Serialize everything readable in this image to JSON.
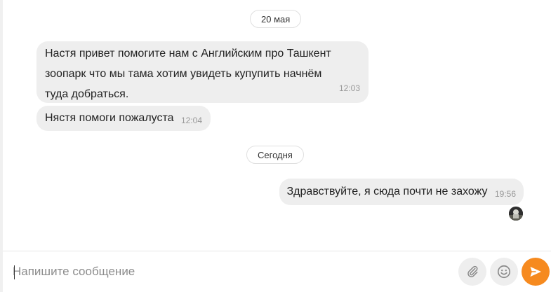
{
  "chat": {
    "date_first": "20 мая",
    "date_today": "Сегодня",
    "messages": [
      {
        "text": "Настя привет помогите нам с Английским про Ташкент\nзоопарк что мы тама хотим увидеть купупить начнём\nтуда добраться.",
        "time": "12:03",
        "direction": "incoming"
      },
      {
        "text": "Нястя помоги пожалуста",
        "time": "12:04",
        "direction": "incoming"
      },
      {
        "text": "Здравствуйте, я сюда почти не захожу",
        "time": "19:56",
        "direction": "outgoing"
      }
    ]
  },
  "composer": {
    "placeholder": "Напишите сообщение",
    "value": ""
  },
  "icons": {
    "attach": "paperclip-icon",
    "emoji": "smiley-icon",
    "send": "send-arrow-icon"
  },
  "colors": {
    "bubble": "#eeeeee",
    "send_button": "#f68a1f",
    "icon_grey": "#8a8a8a",
    "timestamp": "#999999"
  }
}
